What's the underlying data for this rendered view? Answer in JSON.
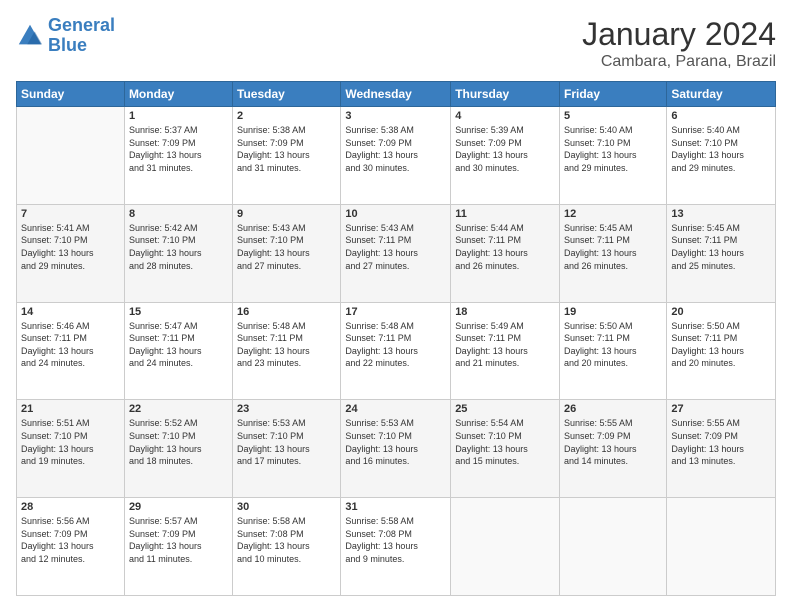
{
  "logo": {
    "line1": "General",
    "line2": "Blue"
  },
  "header": {
    "title": "January 2024",
    "location": "Cambara, Parana, Brazil"
  },
  "weekdays": [
    "Sunday",
    "Monday",
    "Tuesday",
    "Wednesday",
    "Thursday",
    "Friday",
    "Saturday"
  ],
  "weeks": [
    [
      {
        "day": "",
        "info": ""
      },
      {
        "day": "1",
        "info": "Sunrise: 5:37 AM\nSunset: 7:09 PM\nDaylight: 13 hours\nand 31 minutes."
      },
      {
        "day": "2",
        "info": "Sunrise: 5:38 AM\nSunset: 7:09 PM\nDaylight: 13 hours\nand 31 minutes."
      },
      {
        "day": "3",
        "info": "Sunrise: 5:38 AM\nSunset: 7:09 PM\nDaylight: 13 hours\nand 30 minutes."
      },
      {
        "day": "4",
        "info": "Sunrise: 5:39 AM\nSunset: 7:09 PM\nDaylight: 13 hours\nand 30 minutes."
      },
      {
        "day": "5",
        "info": "Sunrise: 5:40 AM\nSunset: 7:10 PM\nDaylight: 13 hours\nand 29 minutes."
      },
      {
        "day": "6",
        "info": "Sunrise: 5:40 AM\nSunset: 7:10 PM\nDaylight: 13 hours\nand 29 minutes."
      }
    ],
    [
      {
        "day": "7",
        "info": "Sunrise: 5:41 AM\nSunset: 7:10 PM\nDaylight: 13 hours\nand 29 minutes."
      },
      {
        "day": "8",
        "info": "Sunrise: 5:42 AM\nSunset: 7:10 PM\nDaylight: 13 hours\nand 28 minutes."
      },
      {
        "day": "9",
        "info": "Sunrise: 5:43 AM\nSunset: 7:10 PM\nDaylight: 13 hours\nand 27 minutes."
      },
      {
        "day": "10",
        "info": "Sunrise: 5:43 AM\nSunset: 7:11 PM\nDaylight: 13 hours\nand 27 minutes."
      },
      {
        "day": "11",
        "info": "Sunrise: 5:44 AM\nSunset: 7:11 PM\nDaylight: 13 hours\nand 26 minutes."
      },
      {
        "day": "12",
        "info": "Sunrise: 5:45 AM\nSunset: 7:11 PM\nDaylight: 13 hours\nand 26 minutes."
      },
      {
        "day": "13",
        "info": "Sunrise: 5:45 AM\nSunset: 7:11 PM\nDaylight: 13 hours\nand 25 minutes."
      }
    ],
    [
      {
        "day": "14",
        "info": "Sunrise: 5:46 AM\nSunset: 7:11 PM\nDaylight: 13 hours\nand 24 minutes."
      },
      {
        "day": "15",
        "info": "Sunrise: 5:47 AM\nSunset: 7:11 PM\nDaylight: 13 hours\nand 24 minutes."
      },
      {
        "day": "16",
        "info": "Sunrise: 5:48 AM\nSunset: 7:11 PM\nDaylight: 13 hours\nand 23 minutes."
      },
      {
        "day": "17",
        "info": "Sunrise: 5:48 AM\nSunset: 7:11 PM\nDaylight: 13 hours\nand 22 minutes."
      },
      {
        "day": "18",
        "info": "Sunrise: 5:49 AM\nSunset: 7:11 PM\nDaylight: 13 hours\nand 21 minutes."
      },
      {
        "day": "19",
        "info": "Sunrise: 5:50 AM\nSunset: 7:11 PM\nDaylight: 13 hours\nand 20 minutes."
      },
      {
        "day": "20",
        "info": "Sunrise: 5:50 AM\nSunset: 7:11 PM\nDaylight: 13 hours\nand 20 minutes."
      }
    ],
    [
      {
        "day": "21",
        "info": "Sunrise: 5:51 AM\nSunset: 7:10 PM\nDaylight: 13 hours\nand 19 minutes."
      },
      {
        "day": "22",
        "info": "Sunrise: 5:52 AM\nSunset: 7:10 PM\nDaylight: 13 hours\nand 18 minutes."
      },
      {
        "day": "23",
        "info": "Sunrise: 5:53 AM\nSunset: 7:10 PM\nDaylight: 13 hours\nand 17 minutes."
      },
      {
        "day": "24",
        "info": "Sunrise: 5:53 AM\nSunset: 7:10 PM\nDaylight: 13 hours\nand 16 minutes."
      },
      {
        "day": "25",
        "info": "Sunrise: 5:54 AM\nSunset: 7:10 PM\nDaylight: 13 hours\nand 15 minutes."
      },
      {
        "day": "26",
        "info": "Sunrise: 5:55 AM\nSunset: 7:09 PM\nDaylight: 13 hours\nand 14 minutes."
      },
      {
        "day": "27",
        "info": "Sunrise: 5:55 AM\nSunset: 7:09 PM\nDaylight: 13 hours\nand 13 minutes."
      }
    ],
    [
      {
        "day": "28",
        "info": "Sunrise: 5:56 AM\nSunset: 7:09 PM\nDaylight: 13 hours\nand 12 minutes."
      },
      {
        "day": "29",
        "info": "Sunrise: 5:57 AM\nSunset: 7:09 PM\nDaylight: 13 hours\nand 11 minutes."
      },
      {
        "day": "30",
        "info": "Sunrise: 5:58 AM\nSunset: 7:08 PM\nDaylight: 13 hours\nand 10 minutes."
      },
      {
        "day": "31",
        "info": "Sunrise: 5:58 AM\nSunset: 7:08 PM\nDaylight: 13 hours\nand 9 minutes."
      },
      {
        "day": "",
        "info": ""
      },
      {
        "day": "",
        "info": ""
      },
      {
        "day": "",
        "info": ""
      }
    ]
  ]
}
